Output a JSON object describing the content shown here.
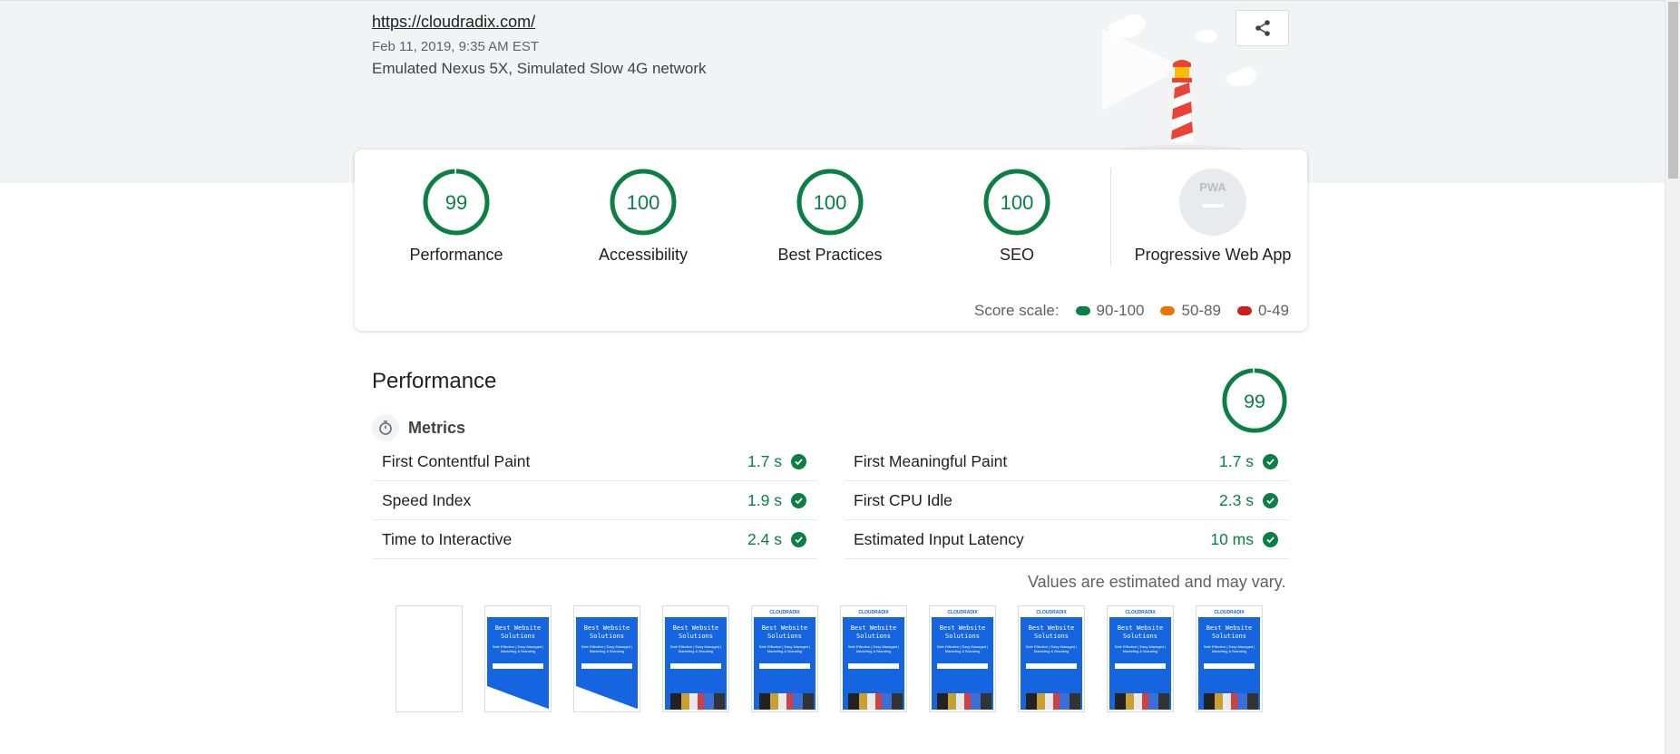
{
  "header": {
    "url": "https://cloudradix.com/",
    "date": "Feb 11, 2019, 9:35 AM EST",
    "device": "Emulated Nexus 5X, Simulated Slow 4G network",
    "share_icon": "share-icon"
  },
  "categories": [
    {
      "label": "Performance",
      "score": "99",
      "score_value": 99
    },
    {
      "label": "Accessibility",
      "score": "100",
      "score_value": 100
    },
    {
      "label": "Best Practices",
      "score": "100",
      "score_value": 100
    },
    {
      "label": "SEO",
      "score": "100",
      "score_value": 100
    },
    {
      "label": "Progressive Web App",
      "score": "PWA",
      "score_value": null
    }
  ],
  "scale": {
    "label": "Score scale:",
    "good": "90-100",
    "average": "50-89",
    "fail": "0-49",
    "colors": {
      "good": "#0c8044",
      "average": "#e67700",
      "fail": "#c7221f"
    }
  },
  "performance": {
    "title": "Performance",
    "score": "99",
    "score_value": 99,
    "metrics_title": "Metrics",
    "metrics_icon": "stopwatch-icon",
    "metrics": [
      {
        "name": "First Contentful Paint",
        "value": "1.7 s"
      },
      {
        "name": "First Meaningful Paint",
        "value": "1.7 s"
      },
      {
        "name": "Speed Index",
        "value": "1.9 s"
      },
      {
        "name": "First CPU Idle",
        "value": "2.3 s"
      },
      {
        "name": "Time to Interactive",
        "value": "2.4 s"
      },
      {
        "name": "Estimated Input Latency",
        "value": "10 ms"
      }
    ],
    "note": "Values are estimated and may vary."
  },
  "filmstrip": {
    "frame_title": "Best Website Solutions",
    "frame_subtitle": "Safe Effective | Easy Managed | Marketing & Branding",
    "frame_logo": "CLOUDRADIX",
    "frames": [
      {
        "kind": "blank"
      },
      {
        "kind": "wedge"
      },
      {
        "kind": "wedge"
      },
      {
        "kind": "pics"
      },
      {
        "kind": "pics-logo"
      },
      {
        "kind": "pics-logo"
      },
      {
        "kind": "pics-logo"
      },
      {
        "kind": "pics-logo"
      },
      {
        "kind": "pics-logo"
      },
      {
        "kind": "pics-logo"
      }
    ]
  },
  "colors": {
    "pass": "#0c8044",
    "band": "#f1f3f4",
    "accent_blue": "#1565e0"
  }
}
